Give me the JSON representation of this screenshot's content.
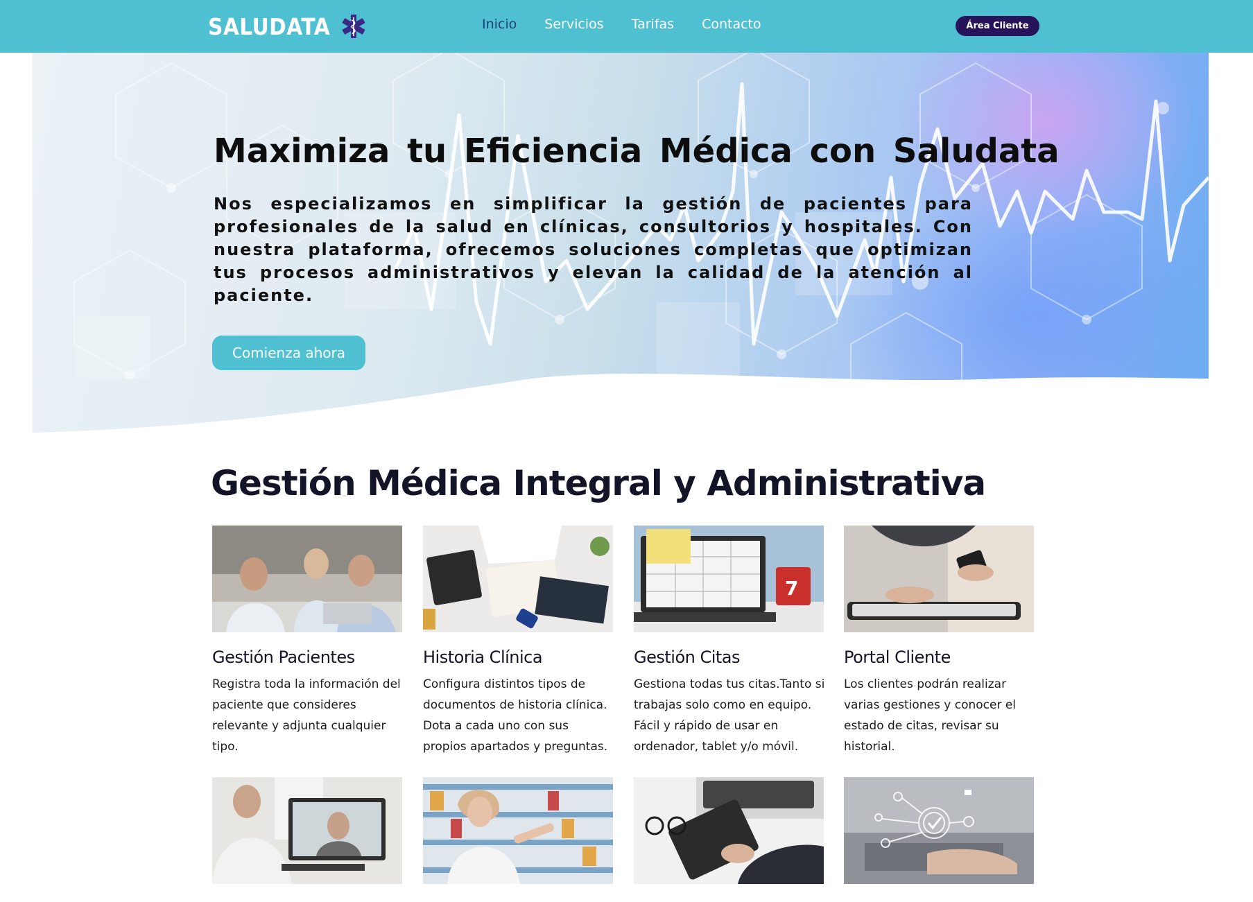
{
  "header": {
    "logo_text": "SALUDATA",
    "nav": [
      "Inicio",
      "Servicios",
      "Tarifas",
      "Contacto"
    ],
    "client_button": "Área Cliente"
  },
  "hero": {
    "title": "Maximiza tu Eficiencia Médica con Saludata",
    "text": "Nos especializamos en simplificar la gestión de pacientes para profesionales de la salud en clínicas, consultorios y hospitales. Con nuestra plataforma, ofrecemos soluciones completas que optimizan tus procesos administrativos y elevan la calidad de la atención al paciente.",
    "cta": "Comienza ahora"
  },
  "section": {
    "title": "Gestión Médica Integral y Administrativa",
    "cards": [
      {
        "title": "Gestión Pacientes",
        "text": "Registra toda la información del paciente que consideres relevante y adjunta cualquier tipo."
      },
      {
        "title": "Historia Clínica",
        "text": "Configura distintos tipos de documentos de historia clínica. Dota a cada uno con sus propios apartados y preguntas."
      },
      {
        "title": "Gestión Citas",
        "text": "Gestiona todas tus citas.Tanto si trabajas solo como en equipo. Fácil y rápido de usar en ordenador, tablet y/o móvil."
      },
      {
        "title": "Portal Cliente",
        "text": "Los clientes podrán realizar varias gestiones y conocer el estado de citas, revisar su historial."
      }
    ]
  },
  "colors": {
    "header_bg": "#4fc0d1",
    "client_button_bg": "#26135a",
    "active_nav": "#1e3f7a",
    "cta_bg": "#4fc0d1"
  },
  "icons": [
    "star-of-life-icon"
  ]
}
